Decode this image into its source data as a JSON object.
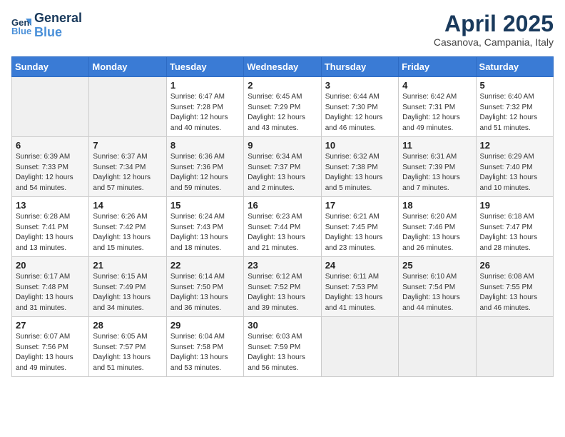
{
  "header": {
    "logo_line1": "General",
    "logo_line2": "Blue",
    "month": "April 2025",
    "location": "Casanova, Campania, Italy"
  },
  "weekdays": [
    "Sunday",
    "Monday",
    "Tuesday",
    "Wednesday",
    "Thursday",
    "Friday",
    "Saturday"
  ],
  "weeks": [
    [
      {
        "day": "",
        "info": ""
      },
      {
        "day": "",
        "info": ""
      },
      {
        "day": "1",
        "info": "Sunrise: 6:47 AM\nSunset: 7:28 PM\nDaylight: 12 hours\nand 40 minutes."
      },
      {
        "day": "2",
        "info": "Sunrise: 6:45 AM\nSunset: 7:29 PM\nDaylight: 12 hours\nand 43 minutes."
      },
      {
        "day": "3",
        "info": "Sunrise: 6:44 AM\nSunset: 7:30 PM\nDaylight: 12 hours\nand 46 minutes."
      },
      {
        "day": "4",
        "info": "Sunrise: 6:42 AM\nSunset: 7:31 PM\nDaylight: 12 hours\nand 49 minutes."
      },
      {
        "day": "5",
        "info": "Sunrise: 6:40 AM\nSunset: 7:32 PM\nDaylight: 12 hours\nand 51 minutes."
      }
    ],
    [
      {
        "day": "6",
        "info": "Sunrise: 6:39 AM\nSunset: 7:33 PM\nDaylight: 12 hours\nand 54 minutes."
      },
      {
        "day": "7",
        "info": "Sunrise: 6:37 AM\nSunset: 7:34 PM\nDaylight: 12 hours\nand 57 minutes."
      },
      {
        "day": "8",
        "info": "Sunrise: 6:36 AM\nSunset: 7:36 PM\nDaylight: 12 hours\nand 59 minutes."
      },
      {
        "day": "9",
        "info": "Sunrise: 6:34 AM\nSunset: 7:37 PM\nDaylight: 13 hours\nand 2 minutes."
      },
      {
        "day": "10",
        "info": "Sunrise: 6:32 AM\nSunset: 7:38 PM\nDaylight: 13 hours\nand 5 minutes."
      },
      {
        "day": "11",
        "info": "Sunrise: 6:31 AM\nSunset: 7:39 PM\nDaylight: 13 hours\nand 7 minutes."
      },
      {
        "day": "12",
        "info": "Sunrise: 6:29 AM\nSunset: 7:40 PM\nDaylight: 13 hours\nand 10 minutes."
      }
    ],
    [
      {
        "day": "13",
        "info": "Sunrise: 6:28 AM\nSunset: 7:41 PM\nDaylight: 13 hours\nand 13 minutes."
      },
      {
        "day": "14",
        "info": "Sunrise: 6:26 AM\nSunset: 7:42 PM\nDaylight: 13 hours\nand 15 minutes."
      },
      {
        "day": "15",
        "info": "Sunrise: 6:24 AM\nSunset: 7:43 PM\nDaylight: 13 hours\nand 18 minutes."
      },
      {
        "day": "16",
        "info": "Sunrise: 6:23 AM\nSunset: 7:44 PM\nDaylight: 13 hours\nand 21 minutes."
      },
      {
        "day": "17",
        "info": "Sunrise: 6:21 AM\nSunset: 7:45 PM\nDaylight: 13 hours\nand 23 minutes."
      },
      {
        "day": "18",
        "info": "Sunrise: 6:20 AM\nSunset: 7:46 PM\nDaylight: 13 hours\nand 26 minutes."
      },
      {
        "day": "19",
        "info": "Sunrise: 6:18 AM\nSunset: 7:47 PM\nDaylight: 13 hours\nand 28 minutes."
      }
    ],
    [
      {
        "day": "20",
        "info": "Sunrise: 6:17 AM\nSunset: 7:48 PM\nDaylight: 13 hours\nand 31 minutes."
      },
      {
        "day": "21",
        "info": "Sunrise: 6:15 AM\nSunset: 7:49 PM\nDaylight: 13 hours\nand 34 minutes."
      },
      {
        "day": "22",
        "info": "Sunrise: 6:14 AM\nSunset: 7:50 PM\nDaylight: 13 hours\nand 36 minutes."
      },
      {
        "day": "23",
        "info": "Sunrise: 6:12 AM\nSunset: 7:52 PM\nDaylight: 13 hours\nand 39 minutes."
      },
      {
        "day": "24",
        "info": "Sunrise: 6:11 AM\nSunset: 7:53 PM\nDaylight: 13 hours\nand 41 minutes."
      },
      {
        "day": "25",
        "info": "Sunrise: 6:10 AM\nSunset: 7:54 PM\nDaylight: 13 hours\nand 44 minutes."
      },
      {
        "day": "26",
        "info": "Sunrise: 6:08 AM\nSunset: 7:55 PM\nDaylight: 13 hours\nand 46 minutes."
      }
    ],
    [
      {
        "day": "27",
        "info": "Sunrise: 6:07 AM\nSunset: 7:56 PM\nDaylight: 13 hours\nand 49 minutes."
      },
      {
        "day": "28",
        "info": "Sunrise: 6:05 AM\nSunset: 7:57 PM\nDaylight: 13 hours\nand 51 minutes."
      },
      {
        "day": "29",
        "info": "Sunrise: 6:04 AM\nSunset: 7:58 PM\nDaylight: 13 hours\nand 53 minutes."
      },
      {
        "day": "30",
        "info": "Sunrise: 6:03 AM\nSunset: 7:59 PM\nDaylight: 13 hours\nand 56 minutes."
      },
      {
        "day": "",
        "info": ""
      },
      {
        "day": "",
        "info": ""
      },
      {
        "day": "",
        "info": ""
      }
    ]
  ]
}
